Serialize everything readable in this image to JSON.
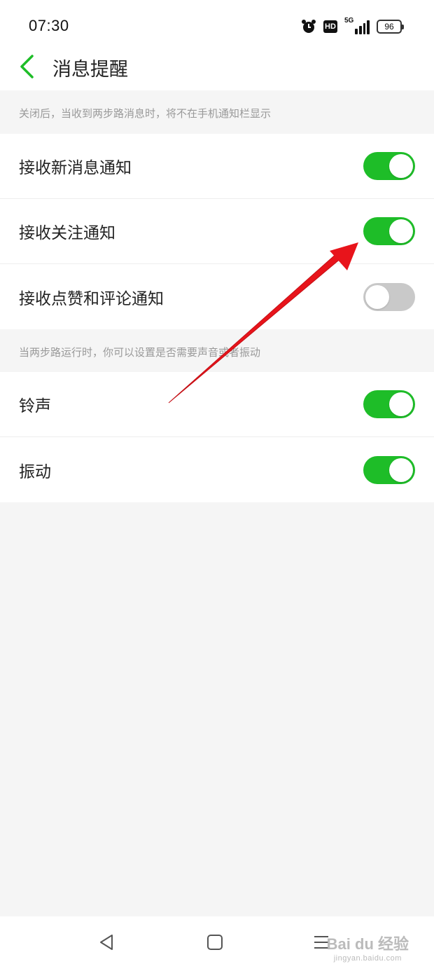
{
  "status_bar": {
    "time": "07:30",
    "hd": "HD",
    "network": "5G",
    "battery": "96"
  },
  "header": {
    "title": "消息提醒",
    "back_icon": "chevron-left-icon",
    "accent_color": "#1ebd28"
  },
  "sections": [
    {
      "caption": "关闭后，当收到两步路消息时，将不在手机通知栏显示",
      "items": [
        {
          "label": "接收新消息通知",
          "enabled": true
        },
        {
          "label": "接收关注通知",
          "enabled": true
        },
        {
          "label": "接收点赞和评论通知",
          "enabled": false
        }
      ]
    },
    {
      "caption": "当两步路运行时，你可以设置是否需要声音或者振动",
      "items": [
        {
          "label": "铃声",
          "enabled": true
        },
        {
          "label": "振动",
          "enabled": true
        }
      ]
    }
  ],
  "annotation": {
    "type": "red-arrow",
    "color": "#e8141b"
  },
  "nav_bar": {
    "buttons": [
      "back-triangle-icon",
      "home-square-icon",
      "menu-lines-icon"
    ]
  },
  "watermark": {
    "main": "Bai du 经验",
    "sub": "jingyan.baidu.com"
  }
}
